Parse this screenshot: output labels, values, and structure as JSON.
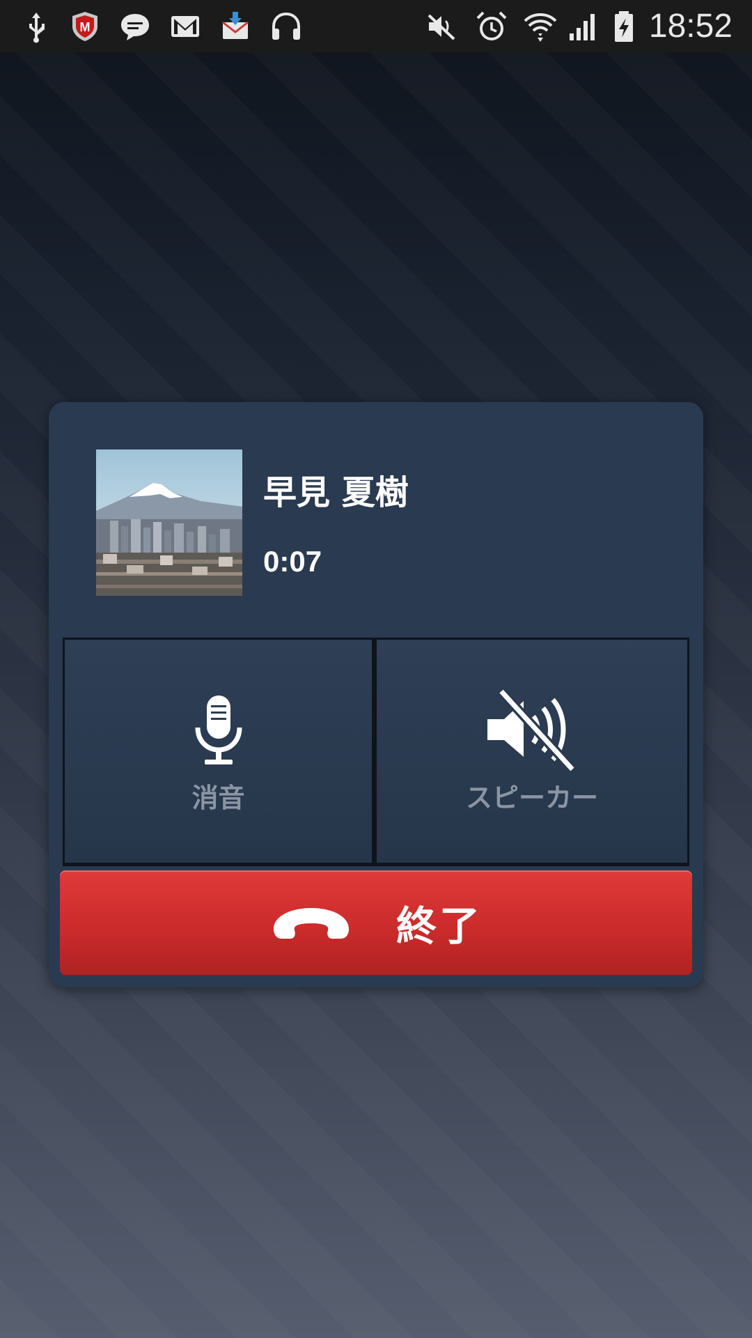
{
  "status_bar": {
    "time": "18:52",
    "left_icons": [
      "usb-icon",
      "mcafee-icon",
      "chat-icon",
      "gmail-icon",
      "download-mail-icon",
      "headphones-icon"
    ],
    "right_icons": [
      "mute-icon",
      "alarm-icon",
      "wifi-icon",
      "signal-icon",
      "battery-charging-icon"
    ]
  },
  "call": {
    "caller_name": "早見 夏樹",
    "duration": "0:07",
    "mute_label": "消音",
    "speaker_label": "スピーカー",
    "end_label": "終了"
  },
  "colors": {
    "card_bg": "#2a3a50",
    "end_button": "#d32f2f",
    "label_gray": "#8b95a3"
  }
}
